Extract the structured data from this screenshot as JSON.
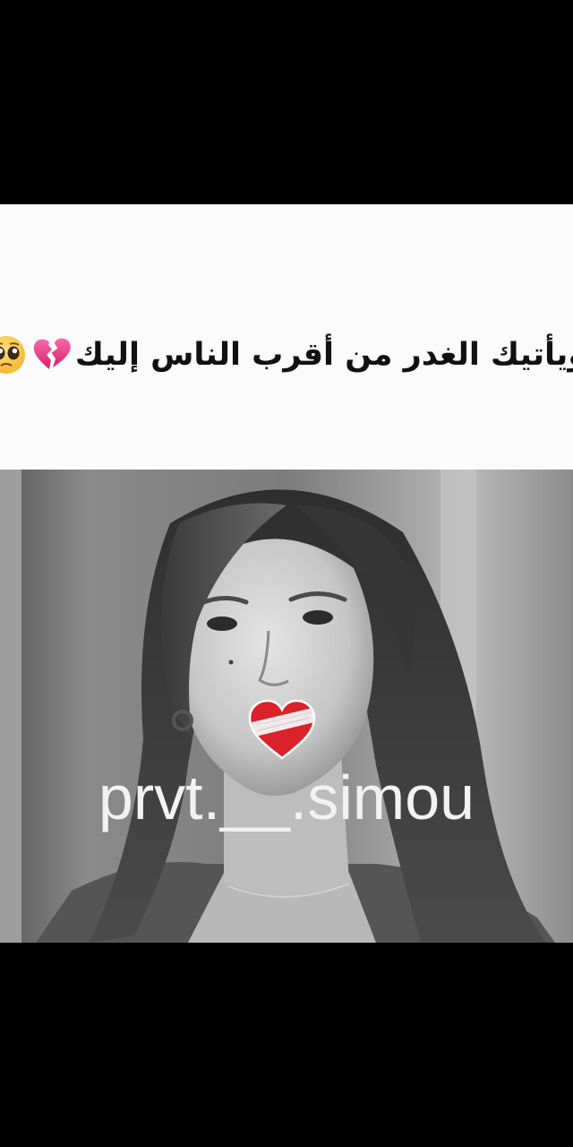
{
  "caption": {
    "text": "ويأتيك الغدر من أقرب الناس إليك",
    "emoji_broken_heart": "broken-heart-icon",
    "emoji_pleading_face": "pleading-face-icon"
  },
  "video": {
    "watermark": "prvt.__.simou",
    "sticker": "bandaged-heart-icon"
  },
  "colors": {
    "caption_panel": "#fbfbfb",
    "caption_text": "#111111",
    "watermark_text": "#f2f2f2",
    "letterbox": "#000000",
    "broken_heart": "#e83e8c",
    "heart_red": "#d9222a"
  }
}
